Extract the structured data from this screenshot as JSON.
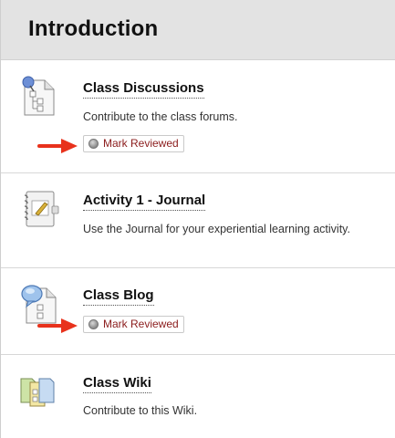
{
  "section": {
    "title": "Introduction"
  },
  "items": [
    {
      "title": "Class Discussions",
      "description": "Contribute to the class forums.",
      "icon": "forum-icon",
      "mark_label": "Mark Reviewed"
    },
    {
      "title": "Activity 1 - Journal",
      "description": "Use the Journal for your experiential learning activity.",
      "icon": "journal-icon"
    },
    {
      "title": "Class Blog",
      "description": "",
      "icon": "blog-icon",
      "mark_label": "Mark Reviewed"
    },
    {
      "title": "Class Wiki",
      "description": "Contribute to this Wiki.",
      "icon": "wiki-icon"
    }
  ],
  "colors": {
    "header_bg": "#e3e3e3",
    "arrow": "#e8321c",
    "mark_text": "#8b1c1c"
  }
}
